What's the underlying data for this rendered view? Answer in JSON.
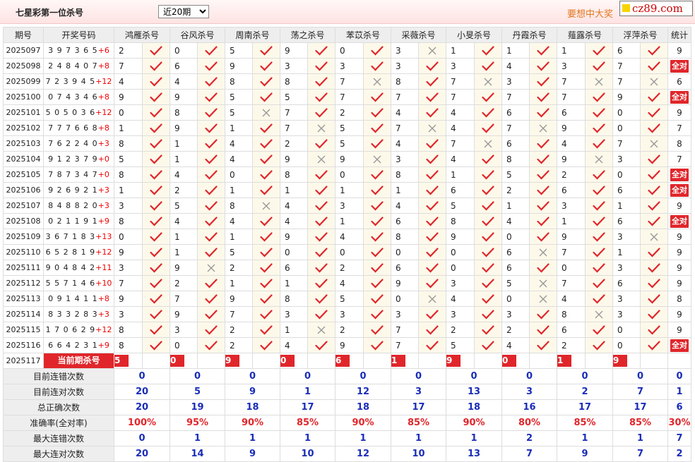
{
  "header": {
    "title": "七星彩第一位杀号",
    "period_select": {
      "selected": "近20期"
    },
    "slogan": "要想中大奖",
    "logo": "cz89.com"
  },
  "table": {
    "columns": {
      "period": "期号",
      "numbers": "开奖号码",
      "experts": [
        "鸿雁杀号",
        "谷风杀号",
        "周南杀号",
        "荡之杀号",
        "苯苡杀号",
        "采薇杀号",
        "小旻杀号",
        "丹霞杀号",
        "薤露杀号",
        "浮萍杀号"
      ],
      "stat": "统计"
    },
    "rows": [
      {
        "period": "2025097",
        "numbers": "3 9 7 3 6 5",
        "plus": "+6",
        "kills": [
          "2",
          "0",
          "5",
          "9",
          "0",
          "3",
          "1",
          "1",
          "1",
          "6"
        ],
        "ok": [
          1,
          1,
          1,
          1,
          1,
          0,
          1,
          1,
          1,
          1
        ],
        "stat": "9"
      },
      {
        "period": "2025098",
        "numbers": "2 4 8 4 0 7",
        "plus": "+8",
        "kills": [
          "7",
          "6",
          "9",
          "3",
          "3",
          "3",
          "3",
          "4",
          "3",
          "7"
        ],
        "ok": [
          1,
          1,
          1,
          1,
          1,
          1,
          1,
          1,
          1,
          1
        ],
        "stat": "全对"
      },
      {
        "period": "2025099",
        "numbers": "7 2 3 9 4 5",
        "plus": "+12",
        "kills": [
          "4",
          "4",
          "8",
          "8",
          "7",
          "8",
          "7",
          "3",
          "7",
          "7"
        ],
        "ok": [
          1,
          1,
          1,
          1,
          0,
          1,
          0,
          1,
          0,
          0
        ],
        "stat": "6"
      },
      {
        "period": "2025100",
        "numbers": "0 7 4 3 4 6",
        "plus": "+8",
        "kills": [
          "9",
          "9",
          "5",
          "5",
          "7",
          "7",
          "7",
          "7",
          "7",
          "9"
        ],
        "ok": [
          1,
          1,
          1,
          1,
          1,
          1,
          1,
          1,
          1,
          1
        ],
        "stat": "全对"
      },
      {
        "period": "2025101",
        "numbers": "5 0 5 0 3 6",
        "plus": "+12",
        "kills": [
          "0",
          "8",
          "5",
          "7",
          "2",
          "4",
          "4",
          "6",
          "6",
          "0"
        ],
        "ok": [
          1,
          1,
          0,
          1,
          1,
          1,
          1,
          1,
          1,
          1
        ],
        "stat": "9"
      },
      {
        "period": "2025102",
        "numbers": "7 7 7 6 6 8",
        "plus": "+8",
        "kills": [
          "1",
          "9",
          "1",
          "7",
          "5",
          "7",
          "4",
          "7",
          "9",
          "0"
        ],
        "ok": [
          1,
          1,
          1,
          0,
          1,
          0,
          1,
          0,
          1,
          1
        ],
        "stat": "7"
      },
      {
        "period": "2025103",
        "numbers": "7 6 2 2 4 0",
        "plus": "+3",
        "kills": [
          "8",
          "1",
          "4",
          "2",
          "5",
          "4",
          "7",
          "6",
          "4",
          "7"
        ],
        "ok": [
          1,
          1,
          1,
          1,
          1,
          1,
          0,
          1,
          1,
          0
        ],
        "stat": "8"
      },
      {
        "period": "2025104",
        "numbers": "9 1 2 3 7 9",
        "plus": "+0",
        "kills": [
          "5",
          "1",
          "4",
          "9",
          "9",
          "3",
          "4",
          "8",
          "9",
          "3"
        ],
        "ok": [
          1,
          1,
          1,
          0,
          0,
          1,
          1,
          1,
          0,
          1
        ],
        "stat": "7"
      },
      {
        "period": "2025105",
        "numbers": "7 8 7 3 4 7",
        "plus": "+0",
        "kills": [
          "8",
          "4",
          "0",
          "8",
          "0",
          "8",
          "1",
          "5",
          "2",
          "0"
        ],
        "ok": [
          1,
          1,
          1,
          1,
          1,
          1,
          1,
          1,
          1,
          1
        ],
        "stat": "全对"
      },
      {
        "period": "2025106",
        "numbers": "9 2 6 9 2 1",
        "plus": "+3",
        "kills": [
          "1",
          "2",
          "1",
          "1",
          "1",
          "1",
          "6",
          "2",
          "6",
          "6"
        ],
        "ok": [
          1,
          1,
          1,
          1,
          1,
          1,
          1,
          1,
          1,
          1
        ],
        "stat": "全对"
      },
      {
        "period": "2025107",
        "numbers": "8 4 8 8 2 0",
        "plus": "+3",
        "kills": [
          "3",
          "5",
          "8",
          "4",
          "3",
          "4",
          "5",
          "1",
          "3",
          "1"
        ],
        "ok": [
          1,
          1,
          0,
          1,
          1,
          1,
          1,
          1,
          1,
          1
        ],
        "stat": "9"
      },
      {
        "period": "2025108",
        "numbers": "0 2 1 1 9 1",
        "plus": "+9",
        "kills": [
          "8",
          "4",
          "4",
          "4",
          "1",
          "6",
          "8",
          "4",
          "1",
          "6"
        ],
        "ok": [
          1,
          1,
          1,
          1,
          1,
          1,
          1,
          1,
          1,
          1
        ],
        "stat": "全对"
      },
      {
        "period": "2025109",
        "numbers": "3 6 7 1 8 3",
        "plus": "+13",
        "kills": [
          "0",
          "1",
          "1",
          "9",
          "4",
          "8",
          "9",
          "0",
          "9",
          "3"
        ],
        "ok": [
          1,
          1,
          1,
          1,
          1,
          1,
          1,
          1,
          1,
          0
        ],
        "stat": "9"
      },
      {
        "period": "2025110",
        "numbers": "6 5 2 8 1 9",
        "plus": "+12",
        "kills": [
          "9",
          "1",
          "5",
          "0",
          "0",
          "0",
          "0",
          "6",
          "7",
          "1"
        ],
        "ok": [
          1,
          1,
          1,
          1,
          1,
          1,
          1,
          0,
          1,
          1
        ],
        "stat": "9"
      },
      {
        "period": "2025111",
        "numbers": "9 0 4 8 4 2",
        "plus": "+11",
        "kills": [
          "3",
          "9",
          "2",
          "6",
          "2",
          "6",
          "0",
          "6",
          "0",
          "3"
        ],
        "ok": [
          1,
          0,
          1,
          1,
          1,
          1,
          1,
          1,
          1,
          1
        ],
        "stat": "9"
      },
      {
        "period": "2025112",
        "numbers": "5 5 7 1 4 6",
        "plus": "+10",
        "kills": [
          "7",
          "2",
          "1",
          "1",
          "4",
          "9",
          "3",
          "5",
          "7",
          "6"
        ],
        "ok": [
          1,
          1,
          1,
          1,
          1,
          1,
          1,
          0,
          1,
          1
        ],
        "stat": "9"
      },
      {
        "period": "2025113",
        "numbers": "0 9 1 4 1 1",
        "plus": "+8",
        "kills": [
          "9",
          "7",
          "9",
          "8",
          "5",
          "0",
          "4",
          "0",
          "4",
          "3"
        ],
        "ok": [
          1,
          1,
          1,
          1,
          1,
          0,
          1,
          0,
          1,
          1
        ],
        "stat": "8"
      },
      {
        "period": "2025114",
        "numbers": "8 3 3 2 8 3",
        "plus": "+3",
        "kills": [
          "3",
          "9",
          "7",
          "3",
          "3",
          "3",
          "3",
          "3",
          "8",
          "3"
        ],
        "ok": [
          1,
          1,
          1,
          1,
          1,
          1,
          1,
          1,
          0,
          1
        ],
        "stat": "9"
      },
      {
        "period": "2025115",
        "numbers": "1 7 0 6 2 9",
        "plus": "+12",
        "kills": [
          "8",
          "3",
          "2",
          "1",
          "2",
          "7",
          "2",
          "2",
          "6",
          "0"
        ],
        "ok": [
          1,
          1,
          1,
          0,
          1,
          1,
          1,
          1,
          1,
          1
        ],
        "stat": "9"
      },
      {
        "period": "2025116",
        "numbers": "6 6 4 2 3 1",
        "plus": "+9",
        "kills": [
          "8",
          "0",
          "2",
          "4",
          "9",
          "7",
          "5",
          "4",
          "2",
          "0"
        ],
        "ok": [
          1,
          1,
          1,
          1,
          1,
          1,
          1,
          1,
          1,
          1
        ],
        "stat": "全对"
      }
    ],
    "current": {
      "period": "2025117",
      "label": "当前期杀号",
      "kills": [
        "5",
        "0",
        "9",
        "0",
        "6",
        "1",
        "9",
        "0",
        "1",
        "9"
      ]
    },
    "stats": [
      {
        "label": "目前连错次数",
        "values": [
          "0",
          "0",
          "0",
          "0",
          "0",
          "0",
          "0",
          "0",
          "0",
          "0"
        ],
        "total": "0",
        "red": false
      },
      {
        "label": "目前连对次数",
        "values": [
          "20",
          "5",
          "9",
          "1",
          "12",
          "3",
          "13",
          "3",
          "2",
          "7"
        ],
        "total": "1",
        "red": false
      },
      {
        "label": "总正确次数",
        "values": [
          "20",
          "19",
          "18",
          "17",
          "18",
          "17",
          "18",
          "16",
          "17",
          "17"
        ],
        "total": "6",
        "red": false
      },
      {
        "label": "准确率(全对率)",
        "values": [
          "100%",
          "95%",
          "90%",
          "85%",
          "90%",
          "85%",
          "90%",
          "80%",
          "85%",
          "85%"
        ],
        "total": "30%",
        "red": true
      },
      {
        "label": "最大连错次数",
        "values": [
          "0",
          "1",
          "1",
          "1",
          "1",
          "1",
          "1",
          "2",
          "1",
          "1"
        ],
        "total": "7",
        "red": false
      },
      {
        "label": "最大连对次数",
        "values": [
          "20",
          "14",
          "9",
          "10",
          "12",
          "10",
          "13",
          "7",
          "9",
          "7"
        ],
        "total": "2",
        "red": false
      }
    ],
    "icons": {
      "correct": "check-icon",
      "wrong": "cross-icon"
    },
    "colors": {
      "accent": "#e0262b",
      "stat_blue": "#1a2db8",
      "check": "#e0262b",
      "cross": "#999999"
    }
  }
}
